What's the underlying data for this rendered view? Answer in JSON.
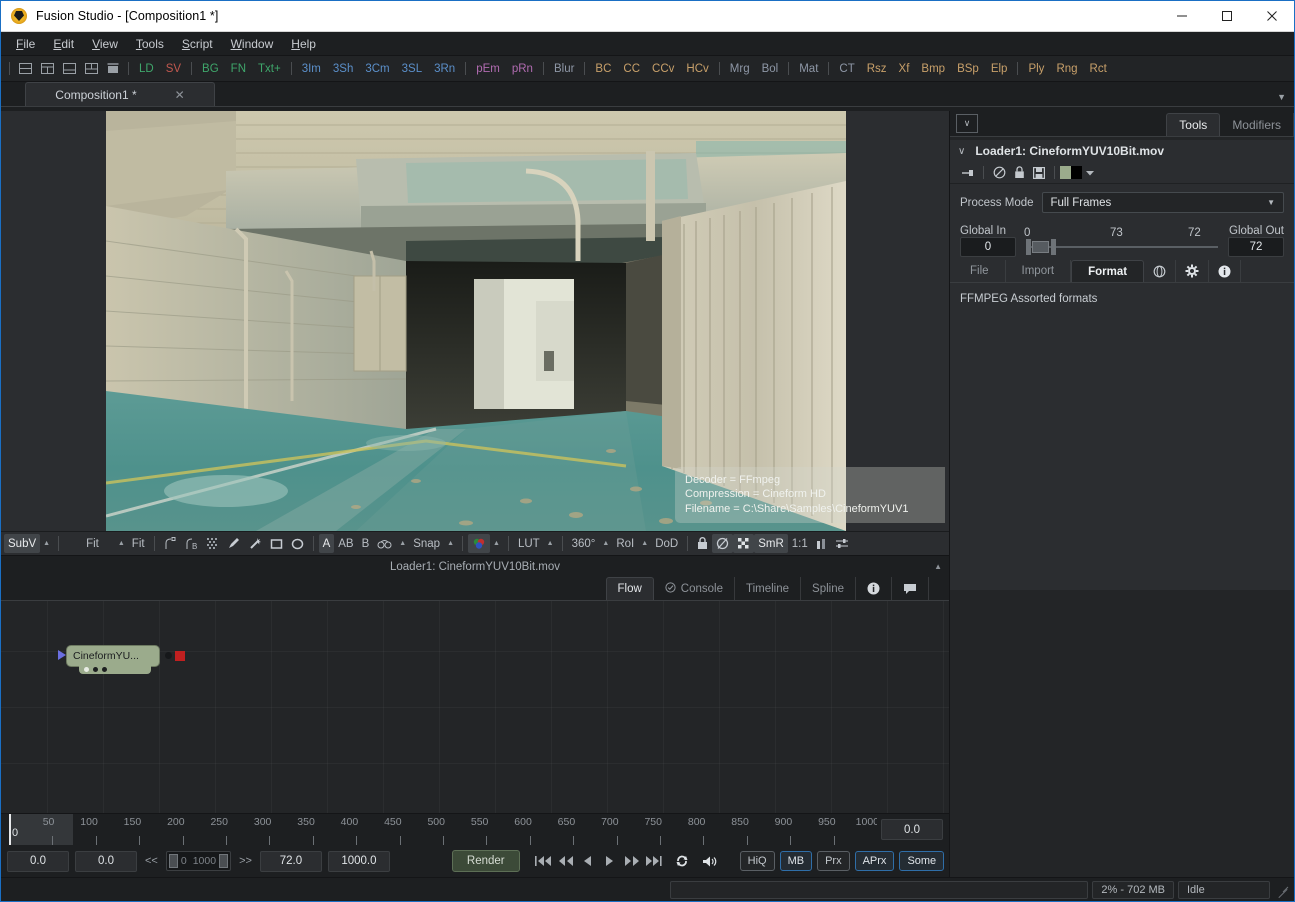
{
  "window": {
    "title": "Fusion Studio - [Composition1 *]",
    "logo_icon": "fusion-logo-icon",
    "controls": {
      "minimize": "minimize-icon",
      "maximize": "maximize-icon",
      "close": "close-icon"
    }
  },
  "menubar": {
    "items": [
      {
        "label": "File",
        "accel": "F"
      },
      {
        "label": "Edit",
        "accel": "E"
      },
      {
        "label": "View",
        "accel": "V"
      },
      {
        "label": "Tools",
        "accel": "T"
      },
      {
        "label": "Script",
        "accel": "S"
      },
      {
        "label": "Window",
        "accel": "W"
      },
      {
        "label": "Help",
        "accel": "H"
      }
    ]
  },
  "toolshelf": {
    "icons": [
      "layout-single-icon",
      "layout-two-icon",
      "layout-grid-icon",
      "layout-split-icon",
      "layout-quad-icon",
      "layout-stack-icon"
    ],
    "tools": [
      {
        "label": "LD",
        "color": "#3fa66b"
      },
      {
        "label": "SV",
        "color": "#c0584f"
      },
      {
        "label": "BG",
        "color": "#3fa66b"
      },
      {
        "label": "FN",
        "color": "#3fa66b"
      },
      {
        "label": "Txt+",
        "color": "#3fa66b"
      },
      {
        "label": "3Im",
        "color": "#5b8fc9"
      },
      {
        "label": "3Sh",
        "color": "#5b8fc9"
      },
      {
        "label": "3Cm",
        "color": "#5b8fc9"
      },
      {
        "label": "3SL",
        "color": "#5b8fc9"
      },
      {
        "label": "3Rn",
        "color": "#5b8fc9"
      },
      {
        "label": "pEm",
        "color": "#b munch"
      },
      {
        "label": "pRn",
        "color": "#b06bb0"
      },
      {
        "label": "Blur",
        "color": "#8e97a6"
      },
      {
        "label": "BC",
        "color": "#c8a06a"
      },
      {
        "label": "CC",
        "color": "#c8a06a"
      },
      {
        "label": "CCv",
        "color": "#c8a06a"
      },
      {
        "label": "HCv",
        "color": "#c8a06a"
      },
      {
        "label": "Mrg",
        "color": "#8e97a6"
      },
      {
        "label": "Bol",
        "color": "#8e97a6"
      },
      {
        "label": "Mat",
        "color": "#8e97a6"
      },
      {
        "label": "CT",
        "color": "#8e97a6"
      },
      {
        "label": "Rsz",
        "color": "#c8a06a"
      },
      {
        "label": "Xf",
        "color": "#c8a06a"
      },
      {
        "label": "Bmp",
        "color": "#c8a06a"
      },
      {
        "label": "BSp",
        "color": "#c8a06a"
      },
      {
        "label": "Elp",
        "color": "#c8a06a"
      },
      {
        "label": "Ply",
        "color": "#c8a06a"
      },
      {
        "label": "Rng",
        "color": "#c8a06a"
      },
      {
        "label": "Rct",
        "color": "#c8a06a"
      }
    ]
  },
  "comp_tabs": {
    "tab_label": "Composition1 *",
    "close_label": "✕",
    "overflow_caret": "▼"
  },
  "viewer": {
    "overlay_lines": [
      "Decoder = FFmpeg",
      "Compression = Cineform HD",
      "Filename = C:\\Share\\Samples\\CineformYUV1"
    ],
    "footer_label": "Loader1: CineformYUV10Bit.mov",
    "footer_arrow": "▲",
    "toolbar": {
      "subv_label": "SubV",
      "fit_a_label": "Fit",
      "fit_b_label": "Fit",
      "letter_a": "A",
      "letter_ab": "AB",
      "letter_b": "B",
      "snap_label": "Snap",
      "lut_label": "LUT",
      "deg_label": "360°",
      "roi_label": "RoI",
      "dod_label": "DoD",
      "smr_label": "SmR",
      "ratio_label": "1:1",
      "icons": [
        "curve-icon",
        "curve-b-icon",
        "dither-grid-icon",
        "pen-icon",
        "wand-icon",
        "rect-icon",
        "ellipse-icon",
        "binocular-icon",
        "color-wheel-icon",
        "lock-icon",
        "alpha-icon",
        "checker-icon",
        "histogram-icon",
        "sliders-icon"
      ]
    }
  },
  "flow": {
    "tabs": [
      {
        "label": "Flow",
        "active": true,
        "icon": ""
      },
      {
        "label": "Console",
        "active": false,
        "icon": "check-circle-icon"
      },
      {
        "label": "Timeline",
        "active": false,
        "icon": ""
      },
      {
        "label": "Spline",
        "active": false,
        "icon": ""
      }
    ],
    "icon_tabs": [
      "info-icon",
      "comment-icon"
    ],
    "node": {
      "label": "CineformYU...",
      "color": "#9bab8c"
    }
  },
  "timeline": {
    "ticks": [
      0,
      50,
      100,
      150,
      200,
      250,
      300,
      350,
      400,
      450,
      500,
      550,
      600,
      650,
      700,
      750,
      800,
      850,
      900,
      950,
      1000
    ],
    "playhead_label": "0",
    "current_value": "0.0",
    "range_start": 0,
    "range_end": 1000
  },
  "transport": {
    "field_1": "0.0",
    "field_2": "0.0",
    "prev_arrows": "<<",
    "next_arrows": ">>",
    "range_min": "0",
    "range_max": "1000",
    "field_3": "72.0",
    "field_4": "1000.0",
    "render_label": "Render",
    "playback_icons": [
      "skip-start-icon",
      "rewind-icon",
      "step-back-icon",
      "play-icon",
      "fast-forward-icon",
      "skip-end-icon",
      "loop-icon",
      "audio-icon"
    ],
    "toggles": [
      {
        "label": "HiQ",
        "active": false
      },
      {
        "label": "MB",
        "active": true
      },
      {
        "label": "Prx",
        "active": false
      },
      {
        "label": "APrx",
        "active": true
      },
      {
        "label": "Some",
        "active": true
      }
    ]
  },
  "statusbar": {
    "memory": "2% - 702 MB",
    "state": "Idle"
  },
  "inspector": {
    "collapse_icon": "chevron-down-icon",
    "tabs": [
      {
        "label": "Tools",
        "active": true
      },
      {
        "label": "Modifiers",
        "active": false
      }
    ],
    "tool_title": "Loader1: CineformYUV10Bit.mov",
    "title_caret": "∨",
    "icon_row": [
      "pin-icon",
      "disable-icon",
      "lock-icon",
      "save-icon",
      "color-swatch-icon",
      "caret-down-icon"
    ],
    "swatch_colors": [
      "#9bab8c",
      "#000000"
    ],
    "process_mode": {
      "label": "Process Mode",
      "value": "Full Frames",
      "caret": "▼"
    },
    "global_in": {
      "label": "Global In",
      "value": "0"
    },
    "global_out": {
      "label": "Global Out",
      "value": "72"
    },
    "slider_marks": {
      "left": "0",
      "mid": "73",
      "right": "72"
    },
    "subtabs": [
      {
        "label": "File",
        "active": false
      },
      {
        "label": "Import",
        "active": false
      },
      {
        "label": "Format",
        "active": true
      }
    ],
    "subtab_icons": [
      "globe-icon",
      "gear-icon",
      "info-icon"
    ],
    "format_note": "FFMPEG Assorted formats"
  }
}
